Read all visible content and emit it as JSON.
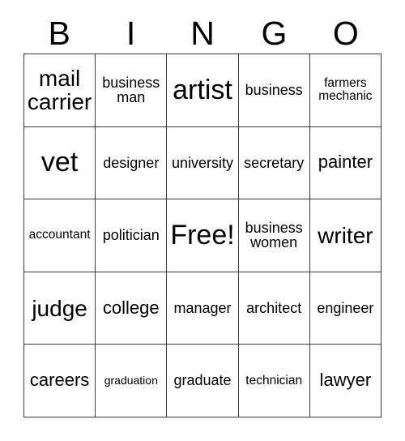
{
  "card": {
    "title": "BINGO",
    "header_letters": [
      "B",
      "I",
      "N",
      "G",
      "O"
    ],
    "columns": 5,
    "rows": 5,
    "free_space_label": "Free!",
    "free_space_position": {
      "row": 3,
      "column": 3
    },
    "colors": {
      "background": "#ffffff",
      "cell_background": "#ffffff",
      "border": "#3a3a3a",
      "text": "#000000"
    },
    "cells": [
      {
        "text": "mail\ncarrier",
        "size": "lg",
        "row": 1,
        "column": 1,
        "free": false
      },
      {
        "text": "business\nman",
        "size": "sm",
        "row": 1,
        "column": 2,
        "free": false
      },
      {
        "text": "artist",
        "size": "xl",
        "row": 1,
        "column": 3,
        "free": false
      },
      {
        "text": "business",
        "size": "sm",
        "row": 1,
        "column": 4,
        "free": false
      },
      {
        "text": "farmers\nmechanic",
        "size": "xs",
        "row": 1,
        "column": 5,
        "free": false
      },
      {
        "text": "vet",
        "size": "xl",
        "row": 2,
        "column": 1,
        "free": false
      },
      {
        "text": "designer",
        "size": "sm",
        "row": 2,
        "column": 2,
        "free": false
      },
      {
        "text": "university",
        "size": "sm",
        "row": 2,
        "column": 3,
        "free": false
      },
      {
        "text": "secretary",
        "size": "sm",
        "row": 2,
        "column": 4,
        "free": false
      },
      {
        "text": "painter",
        "size": "md",
        "row": 2,
        "column": 5,
        "free": false
      },
      {
        "text": "accountant",
        "size": "xs",
        "row": 3,
        "column": 1,
        "free": false
      },
      {
        "text": "politician",
        "size": "sm",
        "row": 3,
        "column": 2,
        "free": false
      },
      {
        "text": "Free!",
        "size": "xl",
        "row": 3,
        "column": 3,
        "free": true
      },
      {
        "text": "business\nwomen",
        "size": "sm",
        "row": 3,
        "column": 4,
        "free": false
      },
      {
        "text": "writer",
        "size": "lg",
        "row": 3,
        "column": 5,
        "free": false
      },
      {
        "text": "judge",
        "size": "lg",
        "row": 4,
        "column": 1,
        "free": false
      },
      {
        "text": "college",
        "size": "md",
        "row": 4,
        "column": 2,
        "free": false
      },
      {
        "text": "manager",
        "size": "sm",
        "row": 4,
        "column": 3,
        "free": false
      },
      {
        "text": "architect",
        "size": "sm",
        "row": 4,
        "column": 4,
        "free": false
      },
      {
        "text": "engineer",
        "size": "sm",
        "row": 4,
        "column": 5,
        "free": false
      },
      {
        "text": "careers",
        "size": "md",
        "row": 5,
        "column": 1,
        "free": false
      },
      {
        "text": "graduation",
        "size": "xxs",
        "row": 5,
        "column": 2,
        "free": false
      },
      {
        "text": "graduate",
        "size": "sm",
        "row": 5,
        "column": 3,
        "free": false
      },
      {
        "text": "technician",
        "size": "xs",
        "row": 5,
        "column": 4,
        "free": false
      },
      {
        "text": "lawyer",
        "size": "md",
        "row": 5,
        "column": 5,
        "free": false
      }
    ]
  }
}
